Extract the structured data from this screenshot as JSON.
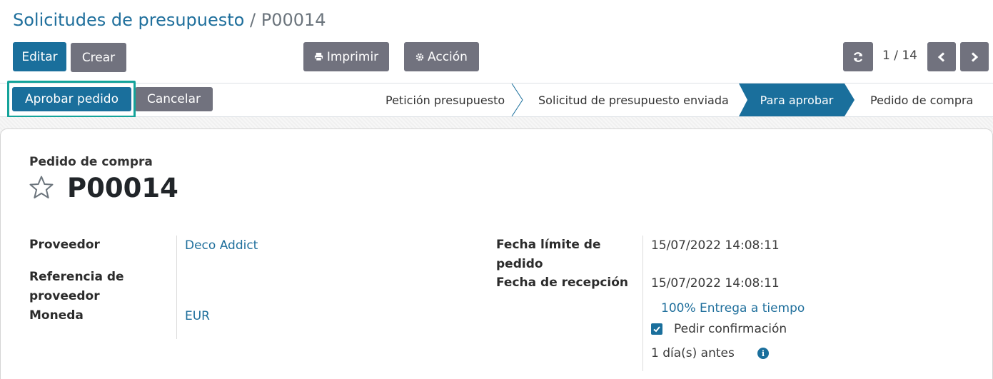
{
  "breadcrumb": {
    "parent": "Solicitudes de presupuesto",
    "separator": "/",
    "current": "P00014"
  },
  "toolbar": {
    "edit_label": "Editar",
    "create_label": "Crear",
    "print_label": "Imprimir",
    "action_label": "Acción",
    "print_icon": "printer-icon",
    "action_icon": "gear-icon"
  },
  "pager": {
    "value": "1 / 14",
    "refresh_icon": "refresh-icon",
    "prev_icon": "chevron-left-icon",
    "next_icon": "chevron-right-icon"
  },
  "statusbar": {
    "approve_label": "Aprobar pedido",
    "cancel_label": "Cancelar",
    "stages": [
      "Petición presupuesto",
      "Solicitud de presupuesto enviada",
      "Para aprobar",
      "Pedido de compra"
    ],
    "active_stage": "Para aprobar"
  },
  "form": {
    "doc_type": "Pedido de compra",
    "doc_name": "P00014",
    "vendor_label": "Proveedor",
    "vendor_value": "Deco Addict",
    "vendor_ref_label": "Referencia de proveedor",
    "currency_label": "Moneda",
    "currency_value": "EUR",
    "deadline_label": "Fecha límite de pedido",
    "deadline_value": "15/07/2022 14:08:11",
    "receipt_label": "Fecha de recepción",
    "receipt_value": "15/07/2022 14:08:11",
    "on_time": "100% Entrega a tiempo",
    "confirm_label": "Pedir confirmación",
    "confirm_checked": true,
    "days_before": "1 día(s) antes"
  },
  "colors": {
    "primary": "#1a6f9c",
    "secondary": "#71727e",
    "highlight": "#14a39a"
  }
}
